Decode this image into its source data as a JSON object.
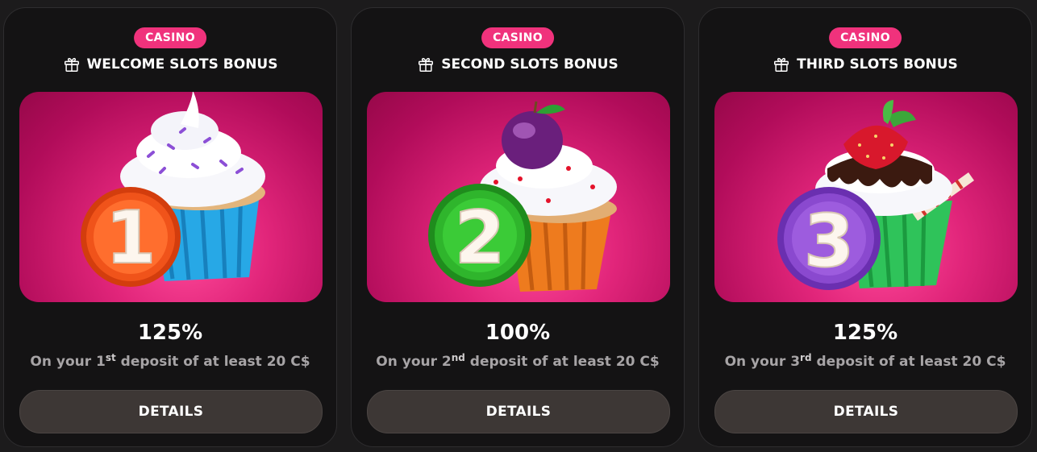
{
  "cards": [
    {
      "badge": "CASINO",
      "title": "WELCOME SLOTS BONUS",
      "percent": "125%",
      "desc_prefix": "On your 1",
      "desc_sup": "st",
      "desc_suffix": " deposit of at least 20 C$",
      "button": "DETAILS",
      "digit": "1",
      "badge_color": "#f0531a",
      "cup_color": "#27a8e6",
      "topping": "sprinkles",
      "icon": "gift-icon"
    },
    {
      "badge": "CASINO",
      "title": "SECOND SLOTS BONUS",
      "percent": "100%",
      "desc_prefix": "On your 2",
      "desc_sup": "nd",
      "desc_suffix": " deposit of at least 20 C$",
      "button": "DETAILS",
      "digit": "2",
      "badge_color": "#2fb52c",
      "cup_color": "#ee7b1e",
      "topping": "plum",
      "icon": "gift-icon"
    },
    {
      "badge": "CASINO",
      "title": "THIRD SLOTS BONUS",
      "percent": "125%",
      "desc_prefix": "On your 3",
      "desc_sup": "rd",
      "desc_suffix": " deposit of at least 20 C$",
      "button": "DETAILS",
      "digit": "3",
      "badge_color": "#8a49cf",
      "cup_color": "#2fc35a",
      "topping": "strawberry",
      "icon": "gift-icon"
    }
  ],
  "colors": {
    "page_bg": "#1c1b1c",
    "card_bg": "#141314",
    "badge_bg": "#f0327c",
    "button_bg": "#3d3735",
    "banner_pink": "#e1257a"
  }
}
